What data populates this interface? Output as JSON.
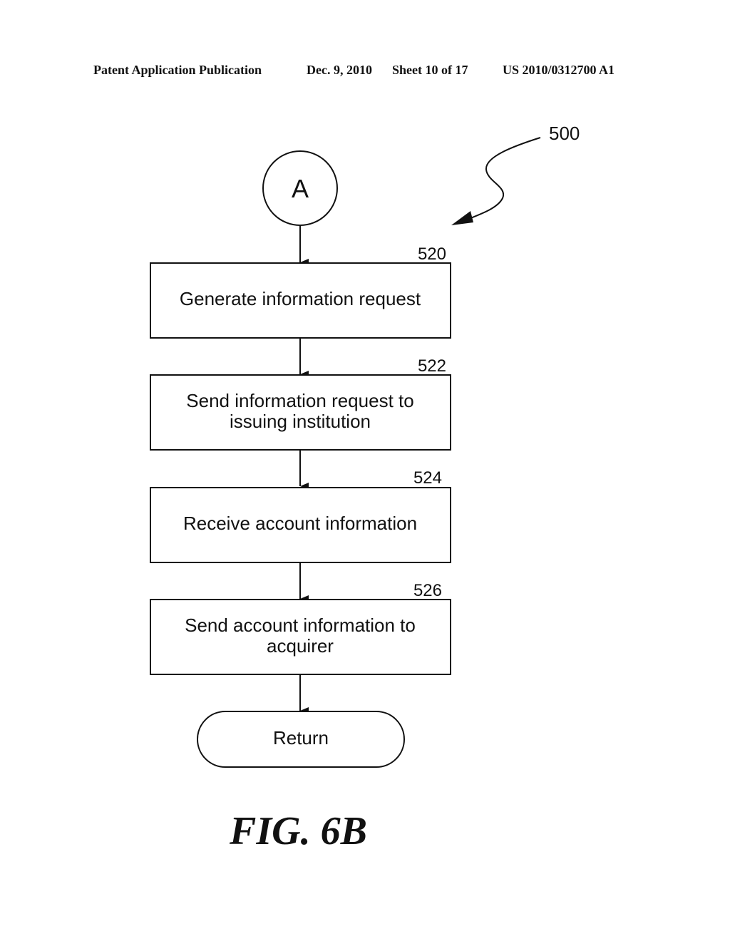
{
  "header": {
    "publication": "Patent Application Publication",
    "date": "Dec. 9, 2010",
    "sheet": "Sheet 10 of 17",
    "patent_number": "US 2010/0312700 A1"
  },
  "diagram": {
    "reference_label": "500",
    "connector": {
      "label": "A"
    },
    "steps": [
      {
        "id": "520",
        "lines": [
          "Generate information request"
        ]
      },
      {
        "id": "522",
        "lines": [
          "Send information request to",
          "issuing institution"
        ]
      },
      {
        "id": "524",
        "lines": [
          "Receive account information"
        ]
      },
      {
        "id": "526",
        "lines": [
          "Send account information to",
          "acquirer"
        ]
      }
    ],
    "terminator": {
      "label": "Return"
    }
  },
  "figure": {
    "title": "FIG. 6B"
  }
}
